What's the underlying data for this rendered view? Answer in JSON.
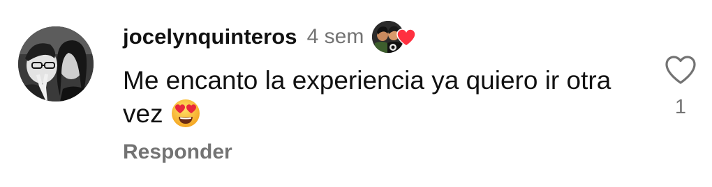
{
  "comment": {
    "username": "jocelynquinteros",
    "timestamp": "4 sem",
    "text": "Me encanto la experiencia ya quiero ir otra vez",
    "emoji": "heart-eyes-emoji",
    "reply_label": "Responder",
    "like_count": "1",
    "creator_liked": true
  },
  "colors": {
    "secondary_text": "#737373",
    "heart_red": "#ff3040",
    "emoji_yellow": "#ffcc33"
  },
  "icons": {
    "like": "heart-outline-icon",
    "creator_like": "heart-filled-icon"
  }
}
